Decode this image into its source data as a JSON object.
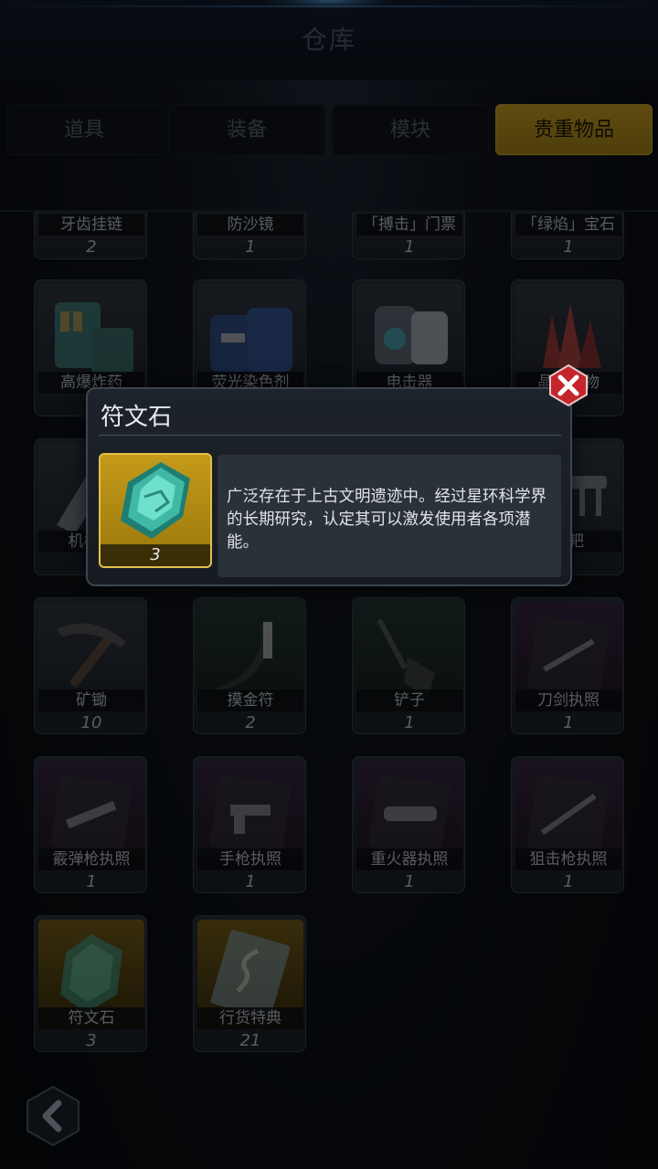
{
  "header": {
    "title": "仓库"
  },
  "tabs": [
    {
      "label": "道具",
      "active": false
    },
    {
      "label": "装备",
      "active": false
    },
    {
      "label": "模块",
      "active": false
    },
    {
      "label": "贵重物品",
      "active": true
    }
  ],
  "items": [
    {
      "name": "牙齿挂链",
      "count": "2",
      "icon": "tooth-chain-icon",
      "rarity": "gray"
    },
    {
      "name": "防沙镜",
      "count": "1",
      "icon": "sand-goggles-icon",
      "rarity": "gray"
    },
    {
      "name": "「搏击」门票",
      "count": "1",
      "icon": "ticket-icon",
      "rarity": "gray"
    },
    {
      "name": "「绿焰」宝石",
      "count": "1",
      "icon": "gem-icon",
      "rarity": "gray"
    },
    {
      "name": "高爆炸药",
      "count": "",
      "icon": "explosive-icon",
      "rarity": "gray"
    },
    {
      "name": "荧光染色剂",
      "count": "",
      "icon": "dye-barrel-icon",
      "rarity": "gray"
    },
    {
      "name": "电击器",
      "count": "",
      "icon": "taser-icon",
      "rarity": "gray"
    },
    {
      "name": "晶体矿物",
      "count": "",
      "icon": "crystal-icon",
      "rarity": "gray"
    },
    {
      "name": "机械臂",
      "count": "",
      "icon": "mech-arm-icon",
      "rarity": "gray"
    },
    {
      "name": "",
      "count": "",
      "icon": "blank-icon",
      "rarity": "gray"
    },
    {
      "name": "",
      "count": "",
      "icon": "blank-icon",
      "rarity": "gray"
    },
    {
      "name": "钉耙",
      "count": "",
      "icon": "rake-icon",
      "rarity": "gray"
    },
    {
      "name": "矿锄",
      "count": "10",
      "icon": "pickaxe-icon",
      "rarity": "gray"
    },
    {
      "name": "摸金符",
      "count": "2",
      "icon": "talisman-icon",
      "rarity": "green"
    },
    {
      "name": "铲子",
      "count": "1",
      "icon": "shovel-icon",
      "rarity": "green"
    },
    {
      "name": "刀剑执照",
      "count": "1",
      "icon": "sword-license-icon",
      "rarity": "purple"
    },
    {
      "name": "霰弹枪执照",
      "count": "1",
      "icon": "shotgun-license-icon",
      "rarity": "purple"
    },
    {
      "name": "手枪执照",
      "count": "1",
      "icon": "pistol-license-icon",
      "rarity": "purple"
    },
    {
      "name": "重火器执照",
      "count": "1",
      "icon": "heavy-weapon-license-icon",
      "rarity": "purple"
    },
    {
      "name": "狙击枪执照",
      "count": "1",
      "icon": "sniper-license-icon",
      "rarity": "purple"
    },
    {
      "name": "符文石",
      "count": "3",
      "icon": "rune-stone-icon",
      "rarity": "gold"
    },
    {
      "name": "行货特典",
      "count": "21",
      "icon": "special-edition-icon",
      "rarity": "gold"
    }
  ],
  "popup": {
    "title": "符文石",
    "count": "3",
    "description": "广泛存在于上古文明遗迹中。经过星环科学界的长期研究，认定其可以激发使用者各项潜能。",
    "icon": "rune-stone-icon"
  },
  "colors": {
    "tab_active": "#9a7a1b",
    "gold_frame": "#e3c04a",
    "close_red": "#c4262c"
  }
}
